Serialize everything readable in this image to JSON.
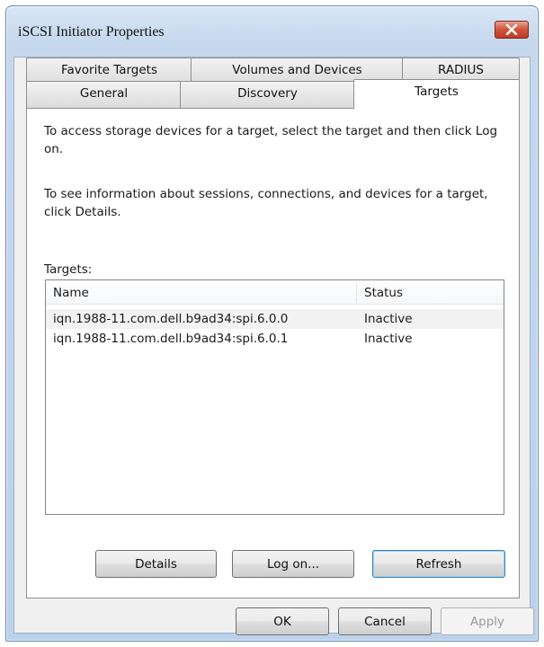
{
  "window": {
    "title": "iSCSI Initiator Properties"
  },
  "tabs": {
    "back_row": [
      "Favorite Targets",
      "Volumes and Devices",
      "RADIUS"
    ],
    "front_row": [
      "General",
      "Discovery",
      "Targets"
    ],
    "active": "Targets"
  },
  "panel": {
    "instruction_1": "To access storage devices for a target, select the target and then click Log on.",
    "instruction_2": "To see information about sessions, connections, and devices for a target, click Details.",
    "targets_label": "Targets:",
    "list": {
      "columns": [
        "Name",
        "Status"
      ],
      "rows": [
        {
          "name": "iqn.1988-11.com.dell.b9ad34:spi.6.0.0",
          "status": "Inactive"
        },
        {
          "name": "iqn.1988-11.com.dell.b9ad34:spi.6.0.1",
          "status": "Inactive"
        }
      ]
    },
    "buttons": {
      "details": "Details",
      "logon": "Log on...",
      "refresh": "Refresh"
    }
  },
  "footer": {
    "ok": "OK",
    "cancel": "Cancel",
    "apply": "Apply",
    "apply_enabled": false
  },
  "colors": {
    "close_button": "#c94a32",
    "title_bar": "#c6d8ee",
    "selected_row": "#f2f2f2"
  },
  "icons": {
    "close": "close-icon"
  }
}
